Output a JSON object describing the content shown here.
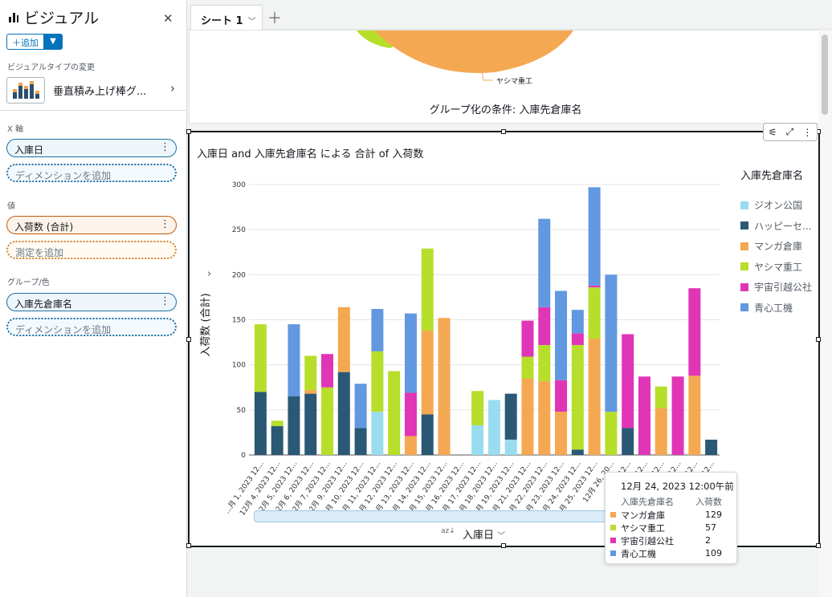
{
  "panel": {
    "title": "ビジュアル",
    "add_label": "追加",
    "visual_type_label": "ビジュアルタイプの変更",
    "visual_type_name": "垂直積み上げ棒グ...",
    "x_axis_label": "X 軸",
    "x_field": "入庫日",
    "x_add": "ディメンションを追加",
    "value_label": "値",
    "value_field": "入荷数 (合計)",
    "value_add": "測定を追加",
    "group_label": "グループ/色",
    "group_field": "入庫先倉庫名",
    "group_add": "ディメンションを追加"
  },
  "tabs": {
    "sheet": "シート 1"
  },
  "top_visual": {
    "group_title": "グループ化の条件: 入庫先倉庫名",
    "pie_label": "ヤシマ重工"
  },
  "chart": {
    "title": "入庫日 and 入庫先倉庫名 による 合計 of 入荷数",
    "ylabel": "入荷数 (合計)",
    "xlabel": "入庫日",
    "legend_title": "入庫先倉庫名"
  },
  "tooltip": {
    "date": "12月 24, 2023 12:00午前",
    "col_name": "入庫先倉庫名",
    "col_value": "入荷数",
    "rows": [
      {
        "name": "マンガ倉庫",
        "value": "129",
        "color": "#f5a852"
      },
      {
        "name": "ヤシマ重工",
        "value": "57",
        "color": "#b6de2b"
      },
      {
        "name": "宇宙引越公社",
        "value": "2",
        "color": "#e035b6"
      },
      {
        "name": "青心工機",
        "value": "109",
        "color": "#6198e0"
      }
    ]
  },
  "chart_data": {
    "type": "bar",
    "stacked": true,
    "title": "入庫日 and 入庫先倉庫名 による 合計 of 入荷数",
    "xlabel": "入庫日",
    "ylabel": "入荷数 (合計)",
    "ylim": [
      0,
      300
    ],
    "yticks": [
      0,
      50,
      100,
      150,
      200,
      250,
      300
    ],
    "categories": [
      "...月 1, 2023 12...",
      "12月 4, 2023 12...",
      "12月 5, 2023 12...",
      "12月 6, 2023 12...",
      "12月 7, 2023 12...",
      "12月 9, 2023 12...",
      "12月 10, 2023 12...",
      "12月 11, 2023 12...",
      "12月 12, 2023 12...",
      "12月 13, 2023 12...",
      "12月 14, 2023 12...",
      "12月 15, 2023 12...",
      "12月 16, 2023 12...",
      "12月 17, 2023 12...",
      "12月 18, 2023 12...",
      "12月 19, 2023 12...",
      "12月 21, 2023 12...",
      "12月 22, 2023 12...",
      "12月 23, 2023 12...",
      "12月 24, 2023 12...",
      "12月 25, 2023 12...",
      "12月 26, 20...",
      "12...",
      "12...",
      "12...",
      "12...",
      "12...",
      "12..."
    ],
    "series": [
      {
        "name": "ジオン公国",
        "color": "#9adcef",
        "values": [
          0,
          0,
          0,
          0,
          0,
          0,
          0,
          48,
          0,
          0,
          0,
          0,
          0,
          33,
          61,
          17,
          0,
          0,
          0,
          0,
          0,
          0,
          0,
          0,
          0,
          0,
          0,
          0
        ]
      },
      {
        "name": "ハッピーセ...",
        "color": "#2b5875",
        "values": [
          70,
          32,
          65,
          68,
          0,
          92,
          30,
          0,
          0,
          0,
          45,
          0,
          0,
          0,
          0,
          51,
          0,
          0,
          0,
          6,
          0,
          0,
          30,
          0,
          0,
          0,
          0,
          17
        ]
      },
      {
        "name": "マンガ倉庫",
        "color": "#f5a852",
        "values": [
          0,
          0,
          0,
          4,
          0,
          72,
          0,
          0,
          0,
          21,
          93,
          152,
          0,
          0,
          0,
          0,
          85,
          82,
          48,
          0,
          129,
          0,
          0,
          0,
          52,
          0,
          88,
          0
        ]
      },
      {
        "name": "ヤシマ重工",
        "color": "#b6de2b",
        "values": [
          75,
          6,
          0,
          38,
          75,
          0,
          0,
          67,
          93,
          0,
          91,
          0,
          0,
          38,
          0,
          0,
          24,
          40,
          0,
          116,
          57,
          48,
          0,
          0,
          24,
          0,
          0,
          0
        ]
      },
      {
        "name": "宇宙引越公社",
        "color": "#e035b6",
        "values": [
          0,
          0,
          0,
          0,
          37,
          0,
          0,
          0,
          0,
          48,
          0,
          0,
          0,
          0,
          0,
          0,
          40,
          42,
          35,
          13,
          2,
          0,
          104,
          87,
          0,
          87,
          97,
          0
        ]
      },
      {
        "name": "青心工機",
        "color": "#6198e0",
        "values": [
          0,
          0,
          80,
          0,
          0,
          0,
          49,
          47,
          0,
          88,
          0,
          0,
          0,
          0,
          0,
          0,
          0,
          98,
          99,
          26,
          109,
          152,
          0,
          0,
          0,
          0,
          0,
          0
        ]
      }
    ]
  }
}
